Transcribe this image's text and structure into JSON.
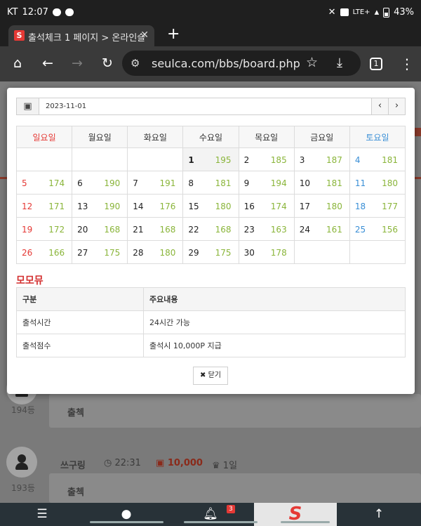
{
  "status_bar": {
    "carrier": "KT",
    "time": "12:07",
    "network": "LTE+",
    "battery": "43%"
  },
  "browser": {
    "tab_title": "출석체크 1 페이지 > 온라인슬",
    "url": "seulca.com/bbs/board.php?bo",
    "tab_count": "1",
    "favicon_letter": "S"
  },
  "background_page": {
    "posts": [
      {
        "rank": "194등",
        "content": "출첵"
      },
      {
        "author": "쓰구링",
        "time": "22:31",
        "points": "10,000",
        "trophy": "1일",
        "rank": "193등",
        "content": "출첵"
      }
    ]
  },
  "bottom_nav": {
    "notification_count": "3",
    "logo": "S"
  },
  "modal": {
    "date": "2023-11-01",
    "prev_icon": "chevron-left-icon",
    "next_icon": "chevron-right-icon",
    "weekdays": [
      "일요일",
      "월요일",
      "화요일",
      "수요일",
      "목요일",
      "금요일",
      "토요일"
    ],
    "weeks": [
      [
        {
          "d": "",
          "c": ""
        },
        {
          "d": "",
          "c": ""
        },
        {
          "d": "",
          "c": ""
        },
        {
          "d": "1",
          "c": "195"
        },
        {
          "d": "2",
          "c": "185"
        },
        {
          "d": "3",
          "c": "187"
        },
        {
          "d": "4",
          "c": "181"
        }
      ],
      [
        {
          "d": "5",
          "c": "174"
        },
        {
          "d": "6",
          "c": "190"
        },
        {
          "d": "7",
          "c": "191"
        },
        {
          "d": "8",
          "c": "181"
        },
        {
          "d": "9",
          "c": "194"
        },
        {
          "d": "10",
          "c": "181"
        },
        {
          "d": "11",
          "c": "180"
        }
      ],
      [
        {
          "d": "12",
          "c": "171"
        },
        {
          "d": "13",
          "c": "190"
        },
        {
          "d": "14",
          "c": "176"
        },
        {
          "d": "15",
          "c": "180"
        },
        {
          "d": "16",
          "c": "174"
        },
        {
          "d": "17",
          "c": "180"
        },
        {
          "d": "18",
          "c": "177"
        }
      ],
      [
        {
          "d": "19",
          "c": "172"
        },
        {
          "d": "20",
          "c": "168"
        },
        {
          "d": "21",
          "c": "168"
        },
        {
          "d": "22",
          "c": "168"
        },
        {
          "d": "23",
          "c": "163"
        },
        {
          "d": "24",
          "c": "161"
        },
        {
          "d": "25",
          "c": "156"
        }
      ],
      [
        {
          "d": "26",
          "c": "166"
        },
        {
          "d": "27",
          "c": "175"
        },
        {
          "d": "28",
          "c": "180"
        },
        {
          "d": "29",
          "c": "175"
        },
        {
          "d": "30",
          "c": "178"
        },
        {
          "d": "",
          "c": ""
        },
        {
          "d": "",
          "c": ""
        }
      ]
    ],
    "section_title": "모모뮤",
    "info_headers": [
      "구분",
      "주요내용"
    ],
    "info_rows": [
      [
        "출석시간",
        "24시간 가능"
      ],
      [
        "출석점수",
        "출석시 10,000P 지급"
      ]
    ],
    "close_label": "닫기"
  },
  "colors": {
    "sunday": "#e53935",
    "saturday": "#3a8fd6",
    "count": "#8ab53a",
    "section": "#d32f2f"
  }
}
